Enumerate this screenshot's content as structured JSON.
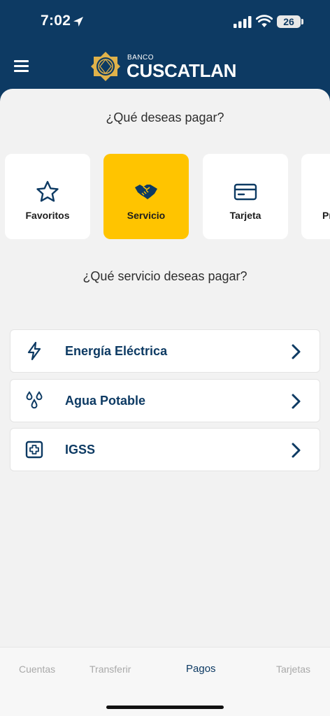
{
  "status_bar": {
    "time": "7:02",
    "battery": "26"
  },
  "header": {
    "bank_small": "BANCO",
    "bank_name": "CUSCATLAN"
  },
  "main": {
    "question_payment": "¿Qué deseas pagar?",
    "categories": [
      {
        "label": "Favoritos",
        "icon": "star-icon",
        "selected": false
      },
      {
        "label": "Servicio",
        "icon": "handshake-icon",
        "selected": true
      },
      {
        "label": "Tarjeta",
        "icon": "credit-card-icon",
        "selected": false
      },
      {
        "label": "Pr",
        "icon": "",
        "selected": false
      }
    ],
    "question_service": "¿Qué servicio deseas pagar?",
    "services": [
      {
        "label": "Energía Eléctrica",
        "icon": "lightning-icon"
      },
      {
        "label": "Agua Potable",
        "icon": "water-drops-icon"
      },
      {
        "label": "IGSS",
        "icon": "medical-cross-icon"
      }
    ]
  },
  "tabbar": {
    "tabs": [
      {
        "label": "Cuentas",
        "active": false
      },
      {
        "label": "Transferir",
        "active": false
      },
      {
        "label": "Pagos",
        "active": true
      },
      {
        "label": "Tarjetas",
        "active": false
      }
    ]
  },
  "colors": {
    "primary": "#0d3a63",
    "accent": "#ffc400",
    "background": "#f2f2f2"
  }
}
